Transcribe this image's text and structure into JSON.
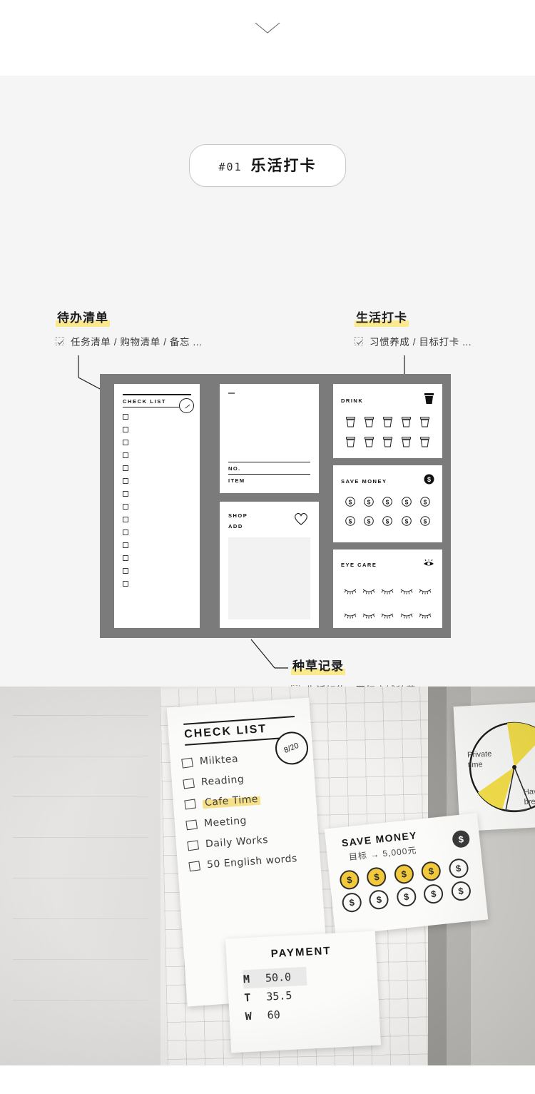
{
  "header": {
    "chevron_icon": "chevron-down-icon"
  },
  "badge": {
    "number": "#01",
    "title": "乐活打卡"
  },
  "annotations": [
    {
      "key": "todo",
      "title": "待办清单",
      "checkbox_icon": "checked-box-icon",
      "desc": "任务清单 / 购物清单 / 备忘 ..."
    },
    {
      "key": "life",
      "title": "生活打卡",
      "checkbox_icon": "checked-box-icon",
      "desc": "习惯养成 / 目标打卡 ..."
    },
    {
      "key": "seed",
      "title": "种草记录",
      "checkbox_icon": "checked-box-icon",
      "desc": "生活好物 / 网红店铺种草..."
    }
  ],
  "product": {
    "background_color": "#7b7b7b",
    "check_card": {
      "title": "CHECK LIST",
      "date_icon": "date-circle-icon",
      "checkbox_count": 14
    },
    "note_card": {
      "dash_icon": "dash-mark-icon",
      "label_no": "NO.",
      "label_item": "ITEM"
    },
    "shop_card": {
      "label_shop": "SHOP",
      "label_add": "ADD",
      "icon": "heart-outline-icon"
    },
    "drink_card": {
      "title": "DRINK",
      "icon": "filled-cup-icon",
      "slot_icon": "cup-outline-icon",
      "slots": 10
    },
    "save_card": {
      "title": "SAVE MONEY",
      "icon": "filled-dollar-coin-icon",
      "slot_icon": "dollar-coin-outline-icon",
      "slot_symbol": "$",
      "slots": 10
    },
    "eye_card": {
      "title": "EYE CARE",
      "icon": "eye-icon",
      "slot_icon": "closed-eye-icon",
      "slots": 10
    }
  },
  "photo": {
    "check_note": {
      "title": "CHECK LIST",
      "date": "8/20",
      "date_top": "8",
      "date_bottom": "20",
      "items": [
        {
          "text": "Milktea",
          "highlighted": false
        },
        {
          "text": "Reading",
          "highlighted": false
        },
        {
          "text": "Cafe Time",
          "highlighted": true
        },
        {
          "text": "Meeting",
          "highlighted": false
        },
        {
          "text": "Daily Works",
          "highlighted": false
        },
        {
          "text": "50 English words",
          "highlighted": false
        }
      ]
    },
    "save_note": {
      "title": "SAVE MONEY",
      "goal": "目标 → 5,000元",
      "icon_symbol": "$",
      "coin_symbol": "$",
      "coins_total": 10,
      "coins_filled": 4,
      "filled_color": "#f2c93b"
    },
    "payment_note": {
      "title": "PAYMENT",
      "rows": [
        {
          "day": "M",
          "amount": "50.0"
        },
        {
          "day": "T",
          "amount": "35.5"
        },
        {
          "day": "W",
          "amount": "60"
        }
      ]
    },
    "pie_note": {
      "label_left": "Private\ntime",
      "label_right": "Have a\nbreak",
      "highlight_color": "#f5e04a"
    }
  }
}
